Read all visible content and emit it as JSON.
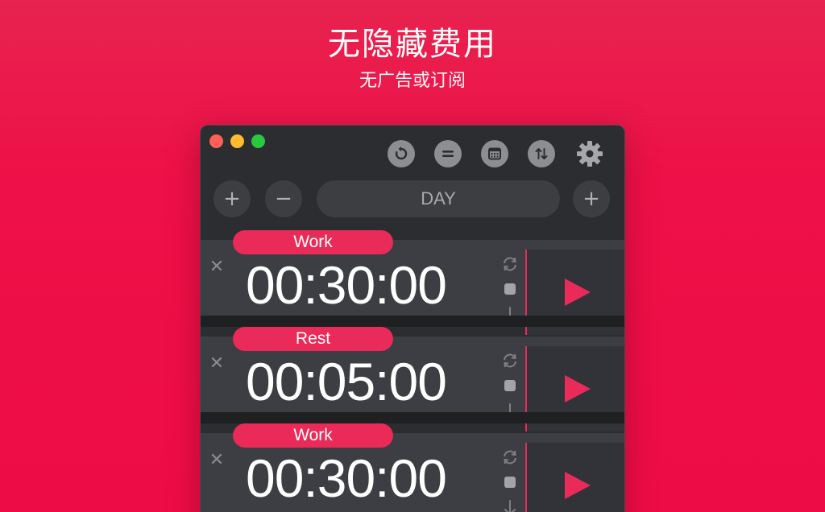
{
  "header": {
    "title": "无隐藏费用",
    "subtitle": "无广告或订阅"
  },
  "window": {
    "toolbar": {
      "icons": [
        "reset-icon",
        "equals-icon",
        "calendar-icon",
        "sort-icon",
        "gear-icon"
      ],
      "gear_color": "#a6a7aa"
    },
    "controls": {
      "left_plus": "+",
      "minus": "−",
      "mode_label": "DAY",
      "right_plus": "+"
    },
    "timers": [
      {
        "label": "Work",
        "time": "00:30:00",
        "close": "✕"
      },
      {
        "label": "Rest",
        "time": "00:05:00",
        "close": "✕"
      },
      {
        "label": "Work",
        "time": "00:30:00",
        "close": "✕"
      }
    ]
  },
  "colors": {
    "accent": "#ea2a58",
    "background_top": "#e8234f",
    "background_bottom": "#ee0c46",
    "window_bg": "#2c2d30"
  }
}
